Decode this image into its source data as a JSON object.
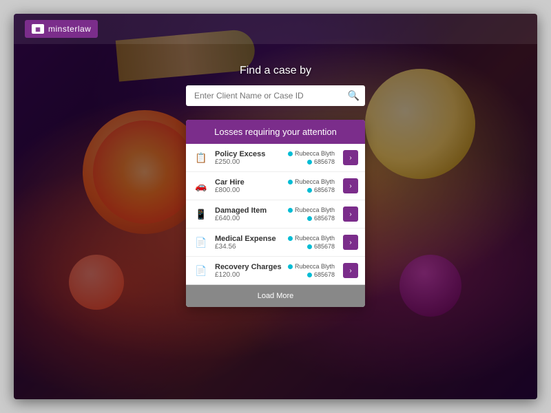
{
  "app": {
    "title": "minster law",
    "logo_text_bold": "minster",
    "logo_text_light": "law"
  },
  "header": {
    "find_title": "Find a case by"
  },
  "search": {
    "placeholder": "Enter Client Name or Case ID"
  },
  "panel": {
    "heading": "Losses requiring your attention"
  },
  "losses": [
    {
      "id": "loss-1",
      "name": "Policy Excess",
      "amount": "£250.00",
      "assignee_name": "Rubecca Blyth",
      "assignee_id": "685678",
      "icon": "📋"
    },
    {
      "id": "loss-2",
      "name": "Car Hire",
      "amount": "£800.00",
      "assignee_name": "Rubecca Blyth",
      "assignee_id": "685678",
      "icon": "🚗"
    },
    {
      "id": "loss-3",
      "name": "Damaged Item",
      "amount": "£640.00",
      "assignee_name": "Rubecca Blyth",
      "assignee_id": "685678",
      "icon": "📱"
    },
    {
      "id": "loss-4",
      "name": "Medical Expense",
      "amount": "£34.56",
      "assignee_name": "Rubecca Blyth",
      "assignee_id": "685678",
      "icon": "📄"
    },
    {
      "id": "loss-5",
      "name": "Recovery Charges",
      "amount": "£120.00",
      "assignee_name": "Rubecca Blyth",
      "assignee_id": "685678",
      "icon": "📄"
    }
  ],
  "buttons": {
    "load_more": "Load More"
  },
  "colors": {
    "brand_purple": "#7b2d8b",
    "teal": "#00bcd4"
  }
}
